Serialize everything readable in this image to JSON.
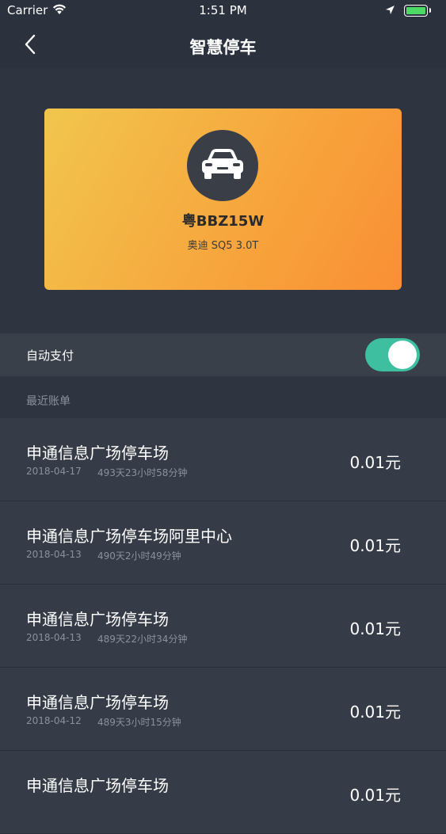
{
  "status_bar": {
    "carrier": "Carrier",
    "time": "1:51 PM",
    "icons": [
      "wifi-icon",
      "location-arrow-icon",
      "battery-icon"
    ],
    "battery_color": "#4cd964"
  },
  "nav": {
    "title": "智慧停车",
    "back_icon": "chevron-left-icon"
  },
  "car": {
    "plate": "粤BBZ15W",
    "model": "奥迪 SQ5 3.0T",
    "icon": "car-icon",
    "card_gradient": [
      "#f1c64d",
      "#f98f35"
    ]
  },
  "auto_pay": {
    "label": "自动支付",
    "enabled": true,
    "toggle_color": "#3ebf9f"
  },
  "bills": {
    "header": "最近账单",
    "items": [
      {
        "name": "申通信息广场停车场",
        "date": "2018-04-17",
        "duration": "493天23小时58分钟",
        "amount": "0.01元"
      },
      {
        "name": "申通信息广场停车场阿里中心",
        "date": "2018-04-13",
        "duration": "490天2小时49分钟",
        "amount": "0.01元"
      },
      {
        "name": "申通信息广场停车场",
        "date": "2018-04-13",
        "duration": "489天22小时34分钟",
        "amount": "0.01元"
      },
      {
        "name": "申通信息广场停车场",
        "date": "2018-04-12",
        "duration": "489天3小时15分钟",
        "amount": "0.01元"
      },
      {
        "name": "申通信息广场停车场",
        "date": "",
        "duration": "",
        "amount": "0.01元"
      }
    ]
  }
}
